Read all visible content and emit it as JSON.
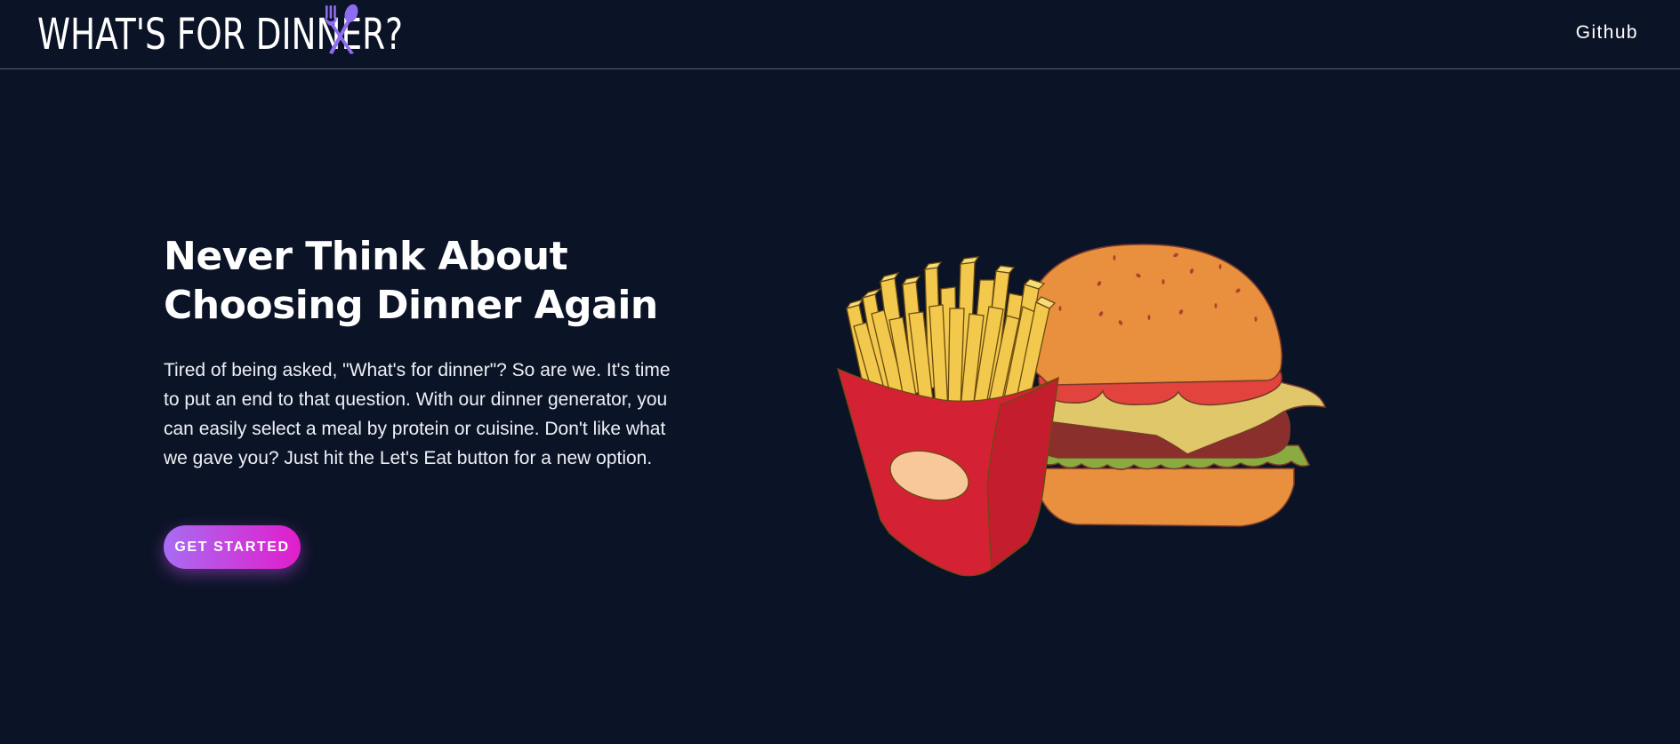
{
  "navbar": {
    "brand_title": "WHAT'S FOR DINNER?",
    "brand_icon": "fork-spoon-icon",
    "github_label": "Github"
  },
  "hero": {
    "heading_line1": "Never Think About",
    "heading_line2": "Choosing Dinner Again",
    "description": "Tired of being asked, \"What's for dinner\"? So are we. It's time to put an end to that question. With our dinner generator, you can easily select a meal by protein or cuisine. Don't like what we gave you? Just hit the Let's Eat button for a new option.",
    "cta_label": "GET STARTED",
    "illustration": "burger-and-fries-illustration"
  },
  "colors": {
    "background": "#0b1326",
    "accent_purple": "#a86cf2",
    "accent_magenta": "#e11dcb",
    "icon_purple": "#8e6cf0"
  }
}
